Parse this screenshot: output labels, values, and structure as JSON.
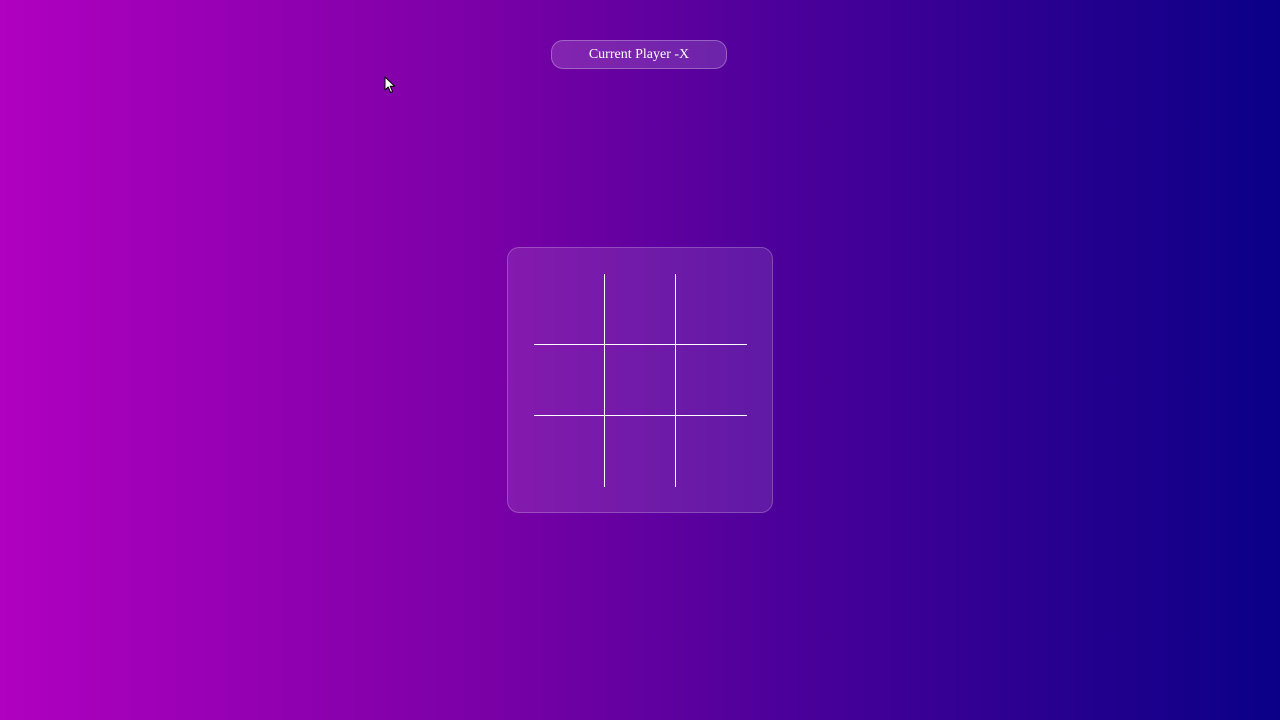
{
  "status": {
    "label": "Current Player -X"
  },
  "board": {
    "cells": [
      "",
      "",
      "",
      "",
      "",
      "",
      "",
      "",
      ""
    ]
  },
  "colors": {
    "gradient_left": "#b000c0",
    "gradient_right": "#0a0087",
    "grid_line": "#ffffff",
    "text": "#ffffff"
  },
  "icons": {
    "cursor": "arrow-cursor-icon"
  }
}
